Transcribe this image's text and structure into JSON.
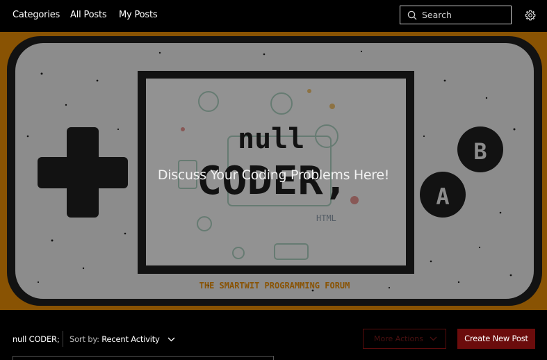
{
  "nav": {
    "categories": "Categories",
    "all_posts": "All Posts",
    "my_posts": "My Posts"
  },
  "search": {
    "placeholder": "Search"
  },
  "banner": {
    "heading": "Discuss Your Coding Problems Here!",
    "logo_line1": "null",
    "logo_line2": "CODER,",
    "tagline": "THE SMARTWIT PROGRAMMING FORUM",
    "button_b": "B",
    "button_a": "A",
    "html_label": "HTML"
  },
  "toolbar": {
    "forum_name": "null CODER;",
    "sort_label": "Sort by:",
    "sort_value": "Recent Activity",
    "more_actions": "More Actions",
    "create_post": "Create New Post"
  },
  "colors": {
    "accent": "#6b0c0c",
    "banner_orange": "#e58a06",
    "console_body": "#e9e9e9",
    "console_dark": "#1e1e1e"
  },
  "icons": [
    "search-icon",
    "gear-icon",
    "chevron-down-icon"
  ]
}
